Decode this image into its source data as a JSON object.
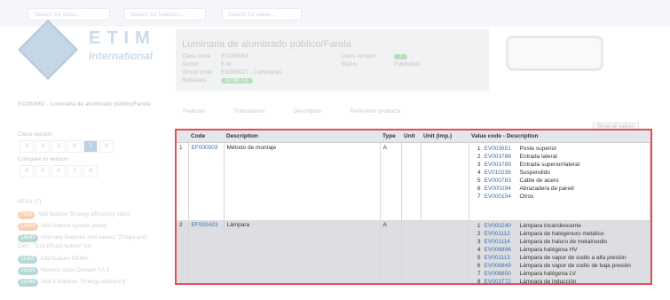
{
  "search": {
    "class_placeholder": "Search for class...",
    "feature_placeholder": "Search for features...",
    "value_placeholder": "Search for value..."
  },
  "logo": {
    "brand": "ETIM",
    "sub": "International"
  },
  "class": {
    "title": "Luminaria de alumbrado público/Farola",
    "fields": [
      {
        "label": "Class code",
        "value": "EC000062"
      },
      {
        "label": "Sector",
        "value": "E M"
      },
      {
        "label": "Group code",
        "value": "EG000027 - Luminarias"
      },
      {
        "label": "Releases",
        "value": "ETIM 7.0"
      }
    ],
    "version_label": "Class version",
    "version_value": "7",
    "status_label": "Status",
    "status_value": "Published",
    "identifier": "EC000062 - Luminaria de alumbrado público/Farola"
  },
  "tabs": [
    "Features",
    "Translations",
    "Description",
    "Reference products"
  ],
  "show_all": "Show all values",
  "class_version": {
    "label": "Class version",
    "items": [
      "3",
      "4",
      "5",
      "6",
      "7",
      "8"
    ],
    "selected": "7"
  },
  "compare": {
    "label": "Compare to version",
    "items": [
      "4",
      "5",
      "6",
      "7",
      "8"
    ]
  },
  "rfcs": {
    "label": "RFCs (7)",
    "items": [
      {
        "id": "7583",
        "text": "Add feature \"Energy efficiency class\"",
        "color": "orange"
      },
      {
        "id": "14609",
        "text": "Add feature system power",
        "color": "orange"
      },
      {
        "id": "14649",
        "text": "Add new features and values \"Zhaga and Dim\", \"DALI/Push button\" etc.",
        "color": "teal"
      },
      {
        "id": "11455",
        "text": "Add feature NEMA",
        "color": "teal"
      },
      {
        "id": "15356",
        "text": "Rework class Domain FA 3",
        "color": "teal"
      },
      {
        "id": "15349",
        "text": "Add 3 features \"Energy efficiency\"",
        "color": "teal"
      }
    ]
  },
  "table": {
    "headers": [
      "Code",
      "Description",
      "Type",
      "Unit",
      "Unit (imp.)",
      "Value code - Description"
    ],
    "rows": [
      {
        "num": "1",
        "code": "EF000003",
        "desc": "Método de montaje",
        "type": "A",
        "unit": "",
        "unit_imp": "",
        "values": [
          {
            "n": "1",
            "code": "EV003651",
            "desc": "Poste superior"
          },
          {
            "n": "2",
            "code": "EV003788",
            "desc": "Entrada lateral"
          },
          {
            "n": "3",
            "code": "EV003789",
            "desc": "Entrada superior/lateral"
          },
          {
            "n": "4",
            "code": "EV010236",
            "desc": "Suspendido"
          },
          {
            "n": "5",
            "code": "EV000783",
            "desc": "Cable de acero"
          },
          {
            "n": "6",
            "code": "EV000294",
            "desc": "Abrazadera de pared"
          },
          {
            "n": "7",
            "code": "EV000154",
            "desc": "Otros"
          }
        ]
      },
      {
        "num": "2",
        "code": "EF002423",
        "desc": "Lámpara",
        "type": "A",
        "unit": "",
        "unit_imp": "",
        "values": [
          {
            "n": "1",
            "code": "EV000240",
            "desc": "Lámpara incandescente"
          },
          {
            "n": "2",
            "code": "EV001112",
            "desc": "Lámpara de halogenuro metálico"
          },
          {
            "n": "3",
            "code": "EV001114",
            "desc": "Lámpara de haluro de metal/sodio"
          },
          {
            "n": "4",
            "code": "EV006896",
            "desc": "Lámpara halógena HV"
          },
          {
            "n": "5",
            "code": "EV001113",
            "desc": "Lámpara de vapor de sodio a alta presión"
          },
          {
            "n": "6",
            "code": "EV006849",
            "desc": "Lámpara de vapor de sodio de baja presión"
          },
          {
            "n": "7",
            "code": "EV006850",
            "desc": "Lámpara halógena LV"
          },
          {
            "n": "8",
            "code": "EV003772",
            "desc": "Lámpara de inducción"
          }
        ]
      }
    ]
  }
}
